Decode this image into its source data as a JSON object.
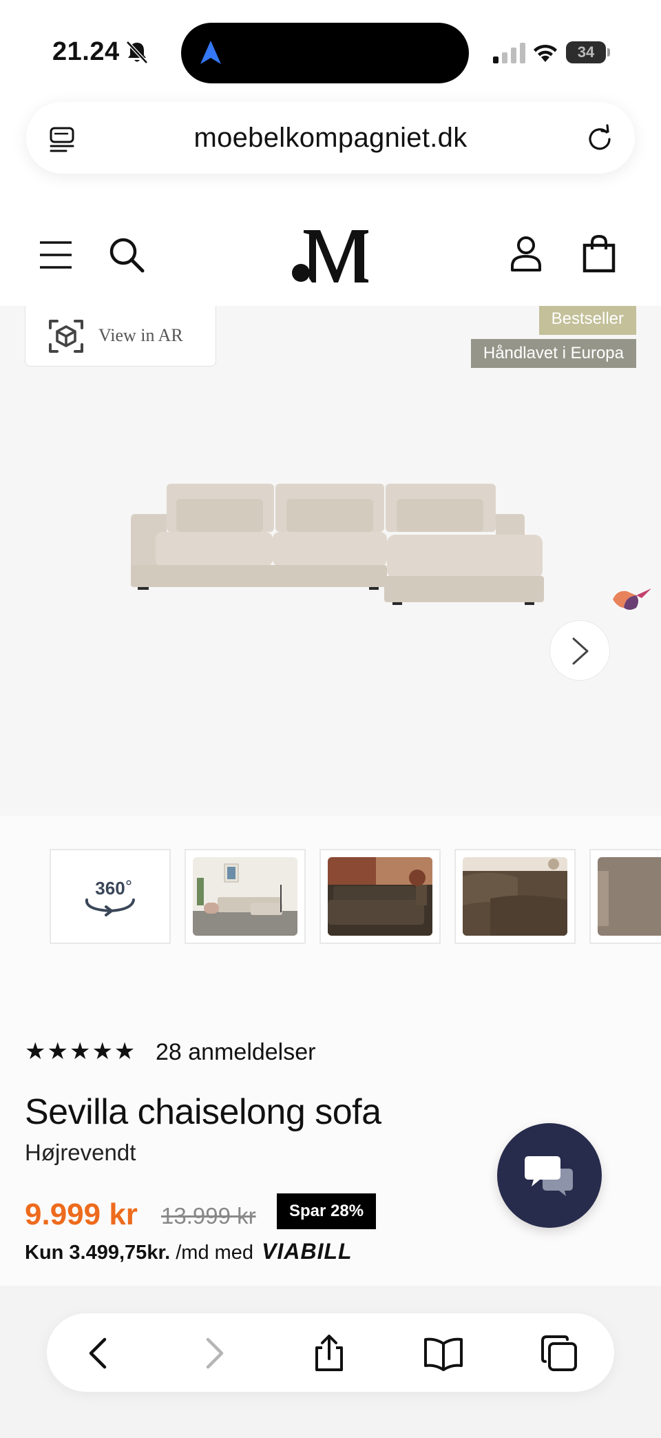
{
  "status_bar": {
    "time": "21.24",
    "battery_level": "34",
    "icons": [
      "bell-slash-icon",
      "navigation-arrow-icon",
      "signal-icon",
      "wifi-icon",
      "battery-icon"
    ]
  },
  "browser": {
    "url": "moebelkompagniet.dk",
    "icons": [
      "reader-mode-icon",
      "reload-icon"
    ]
  },
  "site_header": {
    "icons": [
      "menu-icon",
      "search-icon",
      "logo",
      "account-icon",
      "bag-icon"
    ]
  },
  "hero": {
    "ar_label": "View in AR",
    "badges": [
      "Bestseller",
      "Håndlavet i Europa"
    ]
  },
  "thumbnails": {
    "first_label": "360",
    "count_visible": 5
  },
  "product": {
    "stars": "★★★★★",
    "rating": 5,
    "reviews": "28 anmeldelser",
    "title": "Sevilla chaiselong sofa",
    "variant": "Højrevendt",
    "price": "9.999 kr",
    "old_price": "13.999 kr",
    "save_badge": "Spar 28%",
    "installment_amount": "Kun 3.499,75kr.",
    "installment_text": "/md med",
    "installment_brand": "VIABILL"
  },
  "colors": {
    "price": "#ed6b1d",
    "badge_bestseller": "#c3c09a",
    "badge_handmade": "#959689",
    "chat_button": "#272c4c",
    "ios_blue": "#3478f6"
  }
}
